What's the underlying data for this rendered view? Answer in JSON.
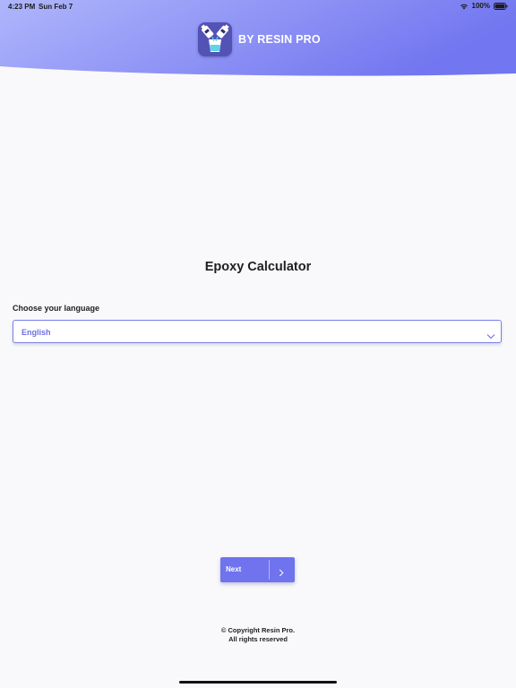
{
  "status_bar": {
    "time": "4:23 PM",
    "date": "Sun Feb 7",
    "battery": "100%"
  },
  "header": {
    "brand": "BY RESIN PRO",
    "gradient_start": "#aeb4fb",
    "gradient_end": "#7074f0",
    "logo_icon": "resin-bottles-cup-icon"
  },
  "main": {
    "title": "Epoxy Calculator",
    "language_label": "Choose your language",
    "language_selected": "English",
    "accent_color": "#6f73ee"
  },
  "actions": {
    "next_label": "Next"
  },
  "footer": {
    "line1": "© Copyright Resin Pro.",
    "line2": "All rights reserved"
  }
}
